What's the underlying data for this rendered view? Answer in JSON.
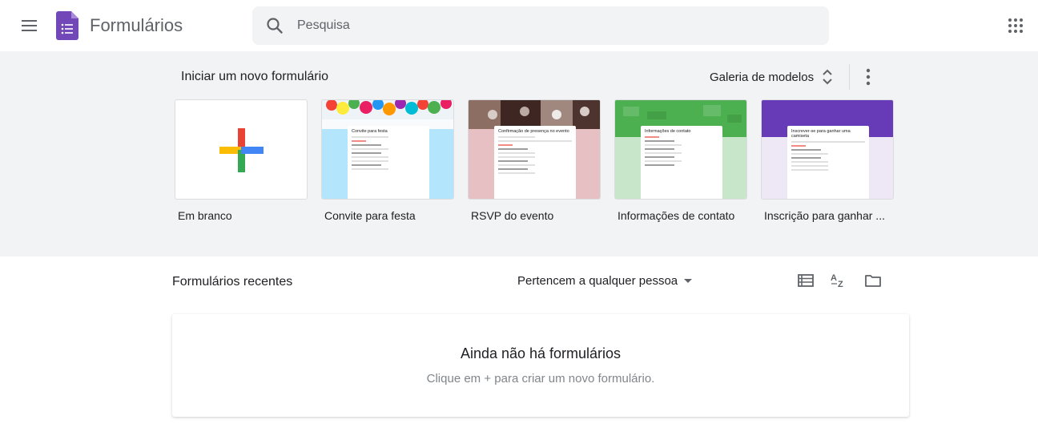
{
  "header": {
    "app_title": "Formulários",
    "search_placeholder": "Pesquisa",
    "search_value": "",
    "menu_icon": "hamburger-menu-icon",
    "apps_icon": "apps-grid-icon",
    "brand_color": "#7248b9"
  },
  "templates": {
    "section_title": "Iniciar um novo formulário",
    "gallery_label": "Galeria de modelos",
    "more_icon": "more-vert-icon",
    "items": [
      {
        "label": "Em branco"
      },
      {
        "label": "Convite para festa",
        "form_title": "Convite para festa"
      },
      {
        "label": "RSVP do evento",
        "form_title": "Confirmação de presença no evento"
      },
      {
        "label": "Informações de contato",
        "form_title": "Informações de contato"
      },
      {
        "label": "Inscrição para ganhar ...",
        "form_title": "Inscrever-se para ganhar uma camiseta"
      }
    ]
  },
  "recent": {
    "title": "Formulários recentes",
    "owner_filter": "Pertencem a qualquer pessoa",
    "empty_title": "Ainda não há formulários",
    "empty_subtitle": "Clique em + para criar um novo formulário."
  },
  "colors": {
    "band_bg": "#f1f3f4",
    "party_bg": "#b3e5fc",
    "rsvp_bg": "#e6c0c3",
    "contact_bg": "#c8e6c9",
    "contact_header": "#4caf50",
    "tshirt_bg": "#ede7f6",
    "tshirt_header": "#673ab7"
  }
}
